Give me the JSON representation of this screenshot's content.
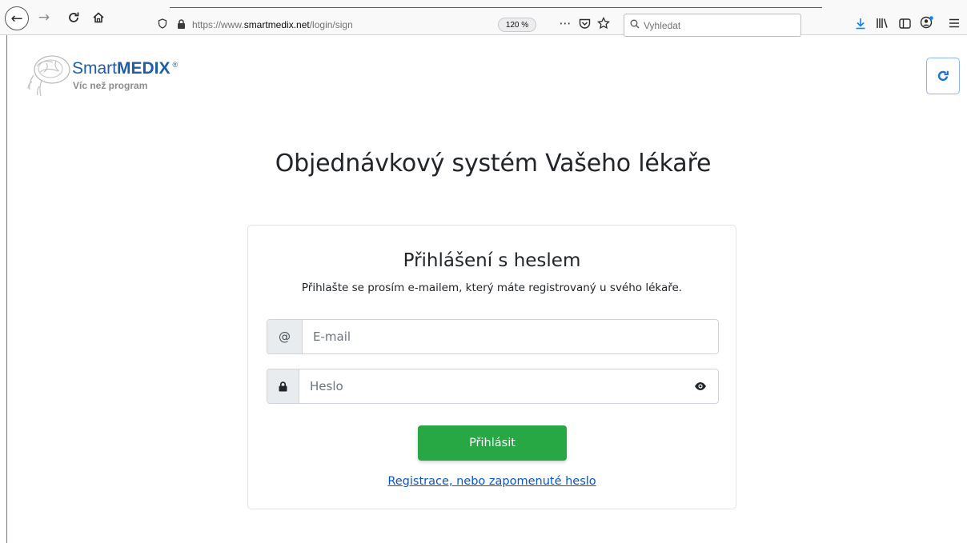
{
  "browser": {
    "url_prefix": "https://www.",
    "url_domain": "smartmedix.net",
    "url_path": "/login/sign",
    "zoom": "120 %",
    "search_placeholder": "Vyhledat",
    "more_label": "⋯"
  },
  "logo": {
    "name_light": "Smart",
    "name_bold": "MEDIX",
    "registered": "®",
    "tagline": "Víc než program"
  },
  "page": {
    "title": "Objednávkový systém Vašeho lékaře"
  },
  "login_card": {
    "title": "Přihlášení s heslem",
    "subtitle": "Přihlašte se prosím e-mailem, který máte registrovaný u svého lékaře.",
    "email_addon": "@",
    "email_placeholder": "E-mail",
    "password_placeholder": "Heslo",
    "submit_label": "Přihlásit",
    "register_link": "Registrace, nebo zapomenuté heslo"
  },
  "colors": {
    "brand_blue": "#1f5da6",
    "submit_green": "#28a745",
    "link_blue": "#0056d6"
  }
}
